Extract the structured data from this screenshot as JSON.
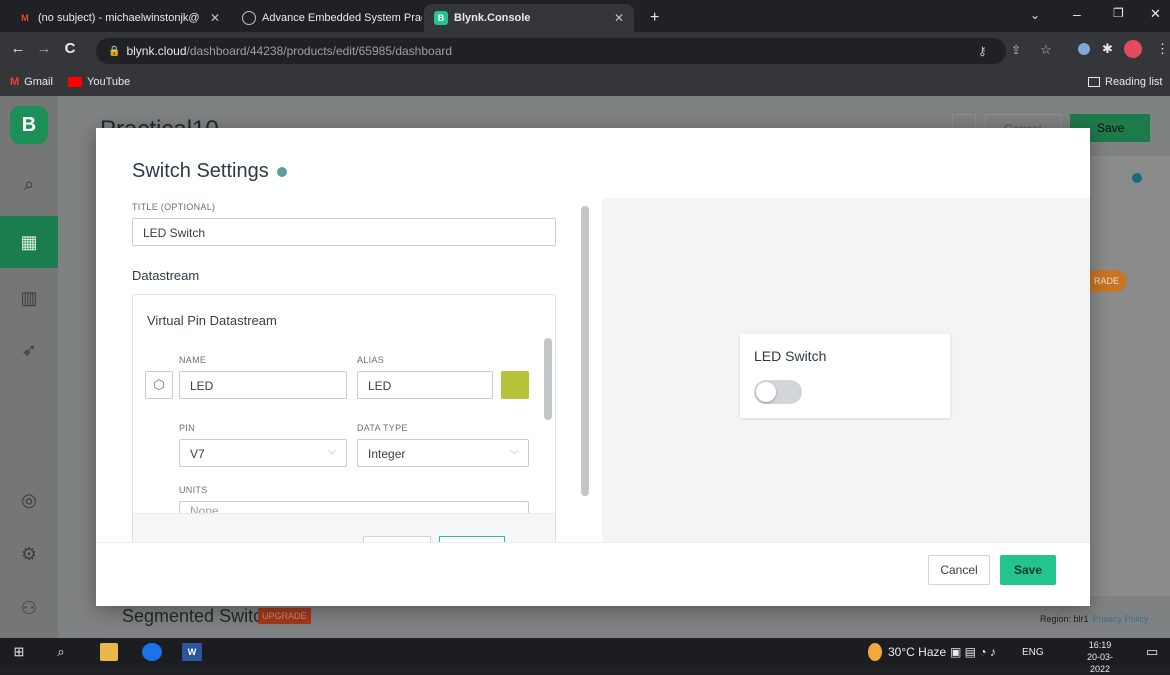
{
  "browser": {
    "tabs": [
      {
        "title": "(no subject) - michaelwinstonjk@",
        "icon": "gmail-icon",
        "active": false
      },
      {
        "title": "Advance Embedded System Prac",
        "icon": "globe-icon",
        "active": false
      },
      {
        "title": "Blynk.Console",
        "icon": "blynk-icon",
        "active": true
      }
    ],
    "new_tab_label": "+",
    "url_host": "blynk.cloud",
    "url_path": "/dashboard/44238/products/edit/65985/dashboard",
    "bookmarks": [
      {
        "label": "Gmail",
        "icon": "gmail-icon"
      },
      {
        "label": "YouTube",
        "icon": "youtube-icon"
      }
    ],
    "reading_list": "Reading list"
  },
  "background": {
    "logo": "B",
    "page_title": "Practical10",
    "cancel_label": "Cancel",
    "save_label": "Save",
    "upgrade_badge": "RADE",
    "segmented_label": "Segmented Switch",
    "upgrade_tag": "UPGRADE",
    "region_label": "Region: blr1",
    "privacy_label": "Privacy Policy"
  },
  "modal": {
    "title": "Switch Settings",
    "title_field_label": "TITLE (OPTIONAL)",
    "title_field_value": "LED Switch",
    "datastream_heading": "Datastream",
    "datastream_card_title": "Virtual Pin Datastream",
    "name_label": "NAME",
    "name_value": "LED",
    "alias_label": "ALIAS",
    "alias_value": "LED",
    "color_value": "#b5c23a",
    "pin_label": "PIN",
    "pin_value": "V7",
    "data_type_label": "DATA TYPE",
    "data_type_value": "Integer",
    "units_label": "UNITS",
    "units_value": "None",
    "preview_title": "LED Switch",
    "cancel_label": "Cancel",
    "save_label": "Save"
  },
  "taskbar": {
    "weather": "30°C Haze",
    "language": "ENG",
    "time": "16:19",
    "date": "20-03-2022"
  },
  "colors": {
    "accent_green": "#23c48e",
    "brand_green": "#1b8f55"
  }
}
